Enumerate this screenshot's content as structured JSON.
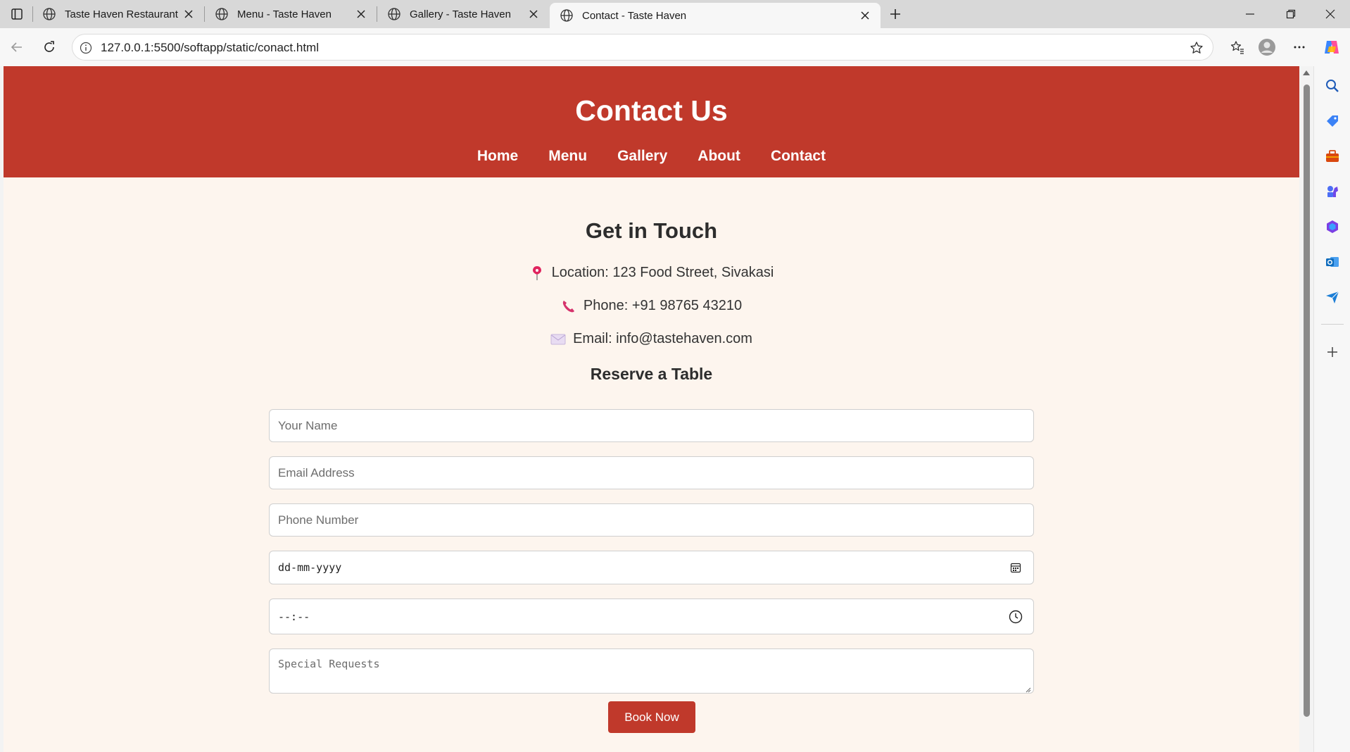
{
  "browser": {
    "tabs": [
      {
        "title": "Taste Haven Restaurant",
        "active": false
      },
      {
        "title": "Menu - Taste Haven",
        "active": false
      },
      {
        "title": "Gallery - Taste Haven",
        "active": false
      },
      {
        "title": "Contact - Taste Haven",
        "active": true
      }
    ],
    "url": "127.0.0.1:5500/softapp/static/conact.html",
    "sidebar_icons": [
      "search-icon",
      "tag-icon",
      "toolbox-icon",
      "chess-icon",
      "office-icon",
      "outlook-icon",
      "send-icon",
      "add-icon"
    ]
  },
  "header": {
    "title": "Contact Us",
    "nav": [
      "Home",
      "Menu",
      "Gallery",
      "About",
      "Contact"
    ]
  },
  "contact": {
    "heading": "Get in Touch",
    "location": "Location: 123 Food Street, Sivakasi",
    "phone": "Phone: +91 98765 43210",
    "email": "Email: info@tastehaven.com"
  },
  "reservation": {
    "heading": "Reserve a Table",
    "name_placeholder": "Your Name",
    "email_placeholder": "Email Address",
    "phone_placeholder": "Phone Number",
    "date_value": "dd-mm-yyyy",
    "time_value": "--:--",
    "requests_placeholder": "Special Requests",
    "submit_label": "Book Now"
  },
  "colors": {
    "brand": "#c0392b",
    "page_background": "#fdf5ee"
  }
}
